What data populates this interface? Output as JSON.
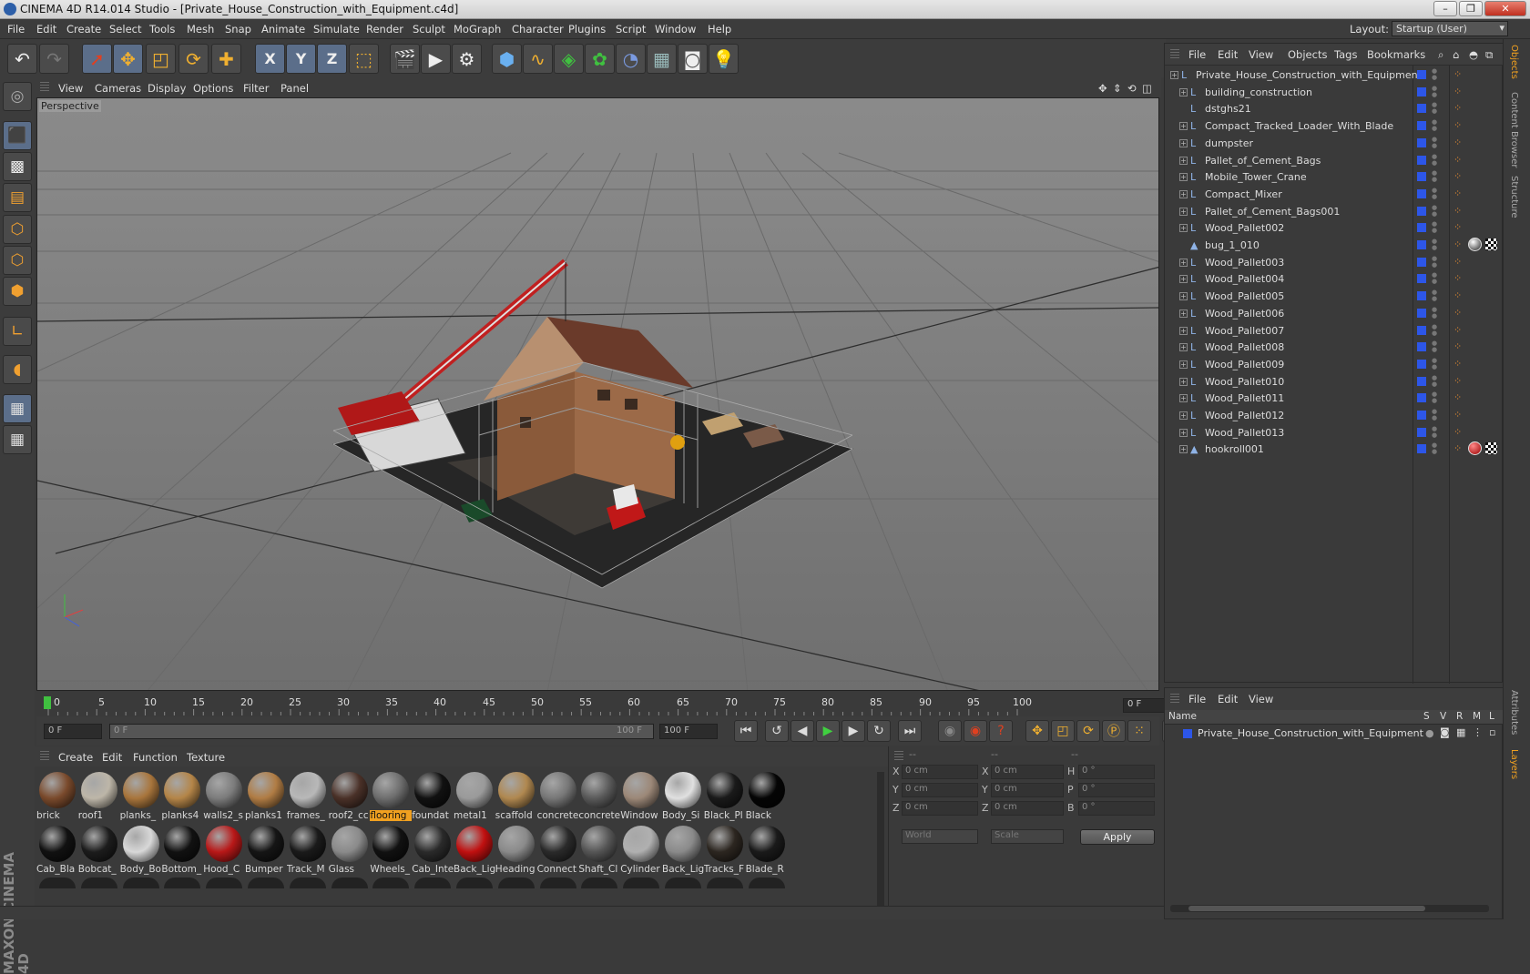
{
  "window": {
    "title": "CINEMA 4D R14.014 Studio - [Private_House_Construction_with_Equipment.c4d]"
  },
  "menubar": {
    "items": [
      "File",
      "Edit",
      "Create",
      "Select",
      "Tools",
      "Mesh",
      "Snap",
      "Animate",
      "Simulate",
      "Render",
      "Sculpt",
      "MoGraph",
      "Character",
      "Plugins",
      "Script",
      "Window",
      "Help"
    ],
    "layout_label": "Layout:",
    "layout_value": "Startup (User)"
  },
  "toolbar": {
    "icons": [
      "undo-icon",
      "redo-icon",
      "live-selection-icon",
      "move-icon",
      "scale-icon",
      "rotate-icon",
      "add-icon",
      "x-axis-icon",
      "y-axis-icon",
      "z-axis-icon",
      "coordinate-system-icon",
      "render-view-icon",
      "render-picture-viewer-icon",
      "render-settings-icon",
      "cube-icon",
      "spline-pen-icon",
      "subdivision-icon",
      "array-icon",
      "deformer-icon",
      "floor-icon",
      "camera-icon",
      "light-icon"
    ],
    "axis_labels": [
      "X",
      "Y",
      "Z"
    ]
  },
  "left_tools": [
    "make-editable-icon",
    "model-mode-icon",
    "texture-mode-icon",
    "workplane-mode-icon",
    "points-mode-icon",
    "edges-mode-icon",
    "polygons-mode-icon",
    "axis-mode-icon",
    "tweak-mode-icon",
    "snap-grid-icon",
    "lock-workplane-icon"
  ],
  "brand": "MAXON CINEMA 4D",
  "viewport": {
    "menu": [
      "View",
      "Cameras",
      "Display",
      "Options",
      "Filter",
      "Panel"
    ],
    "label": "Perspective"
  },
  "timeline": {
    "ticks": [
      "0",
      "5",
      "10",
      "15",
      "20",
      "25",
      "30",
      "35",
      "40",
      "45",
      "50",
      "55",
      "60",
      "65",
      "70",
      "75",
      "80",
      "85",
      "90",
      "95",
      "100"
    ],
    "current_frame": "0 F"
  },
  "transport": {
    "start_field": "0 F",
    "range_start": "0 F",
    "range_end": "100 F",
    "end_field": "100 F"
  },
  "material_manager": {
    "menu": [
      "Create",
      "Edit",
      "Function",
      "Texture"
    ],
    "materials": [
      {
        "name": "brick",
        "color": "#7a4a2c"
      },
      {
        "name": "roof1",
        "color": "#bdb6a8"
      },
      {
        "name": "planks_",
        "color": "#a8753c"
      },
      {
        "name": "planks4",
        "color": "#b48548"
      },
      {
        "name": "walls2_s",
        "color": "#7c7c7c"
      },
      {
        "name": "planks1",
        "color": "#b07c44"
      },
      {
        "name": "frames_",
        "color": "#b8b8b8"
      },
      {
        "name": "roof2_cc",
        "color": "#4a3128"
      },
      {
        "name": "flooring",
        "color": "#6e6e6e",
        "selected": true
      },
      {
        "name": "foundat",
        "color": "#111111"
      },
      {
        "name": "metal1",
        "color": "#9a9a9a"
      },
      {
        "name": "scaffold",
        "color": "#b08850"
      },
      {
        "name": "concrete",
        "color": "#777777"
      },
      {
        "name": "concrete",
        "color": "#5a5a5a"
      },
      {
        "name": "Window",
        "color": "#9c8878"
      },
      {
        "name": "Body_Si",
        "color": "#e0e0e0"
      },
      {
        "name": "Black_Pl",
        "color": "#1a1a1a"
      },
      {
        "name": "Black",
        "color": "#050505"
      },
      {
        "name": "Cab_Bla",
        "color": "#111111"
      },
      {
        "name": "Bobcat_",
        "color": "#1c1c1c"
      },
      {
        "name": "Body_Bo",
        "color": "#d8d8d8"
      },
      {
        "name": "Bottom_",
        "color": "#111111"
      },
      {
        "name": "Hood_C",
        "color": "#b81818"
      },
      {
        "name": "Bumper",
        "color": "#151515"
      },
      {
        "name": "Track_M",
        "color": "#1a1a1a"
      },
      {
        "name": "Glass",
        "color": "#8a8a8a"
      },
      {
        "name": "Wheels_",
        "color": "#111111"
      },
      {
        "name": "Cab_Inte",
        "color": "#2a2a2a"
      },
      {
        "name": "Back_Lig",
        "color": "#c01010"
      },
      {
        "name": "Heading",
        "color": "#8a8a8a"
      },
      {
        "name": "Connect",
        "color": "#2a2a2a"
      },
      {
        "name": "Shaft_Cl",
        "color": "#555555"
      },
      {
        "name": "Cylinder",
        "color": "#b0b0b0"
      },
      {
        "name": "Back_Lig",
        "color": "#8a8a8a"
      },
      {
        "name": "Tracks_F",
        "color": "#2c2620"
      },
      {
        "name": "Blade_R",
        "color": "#1a1a1a"
      }
    ]
  },
  "coordinates": {
    "col_headers": [
      "--",
      "--",
      "--"
    ],
    "rows": [
      {
        "a": "X",
        "av": "0 cm",
        "b": "X",
        "bv": "0 cm",
        "c": "H",
        "cv": "0 °"
      },
      {
        "a": "Y",
        "av": "0 cm",
        "b": "Y",
        "bv": "0 cm",
        "c": "P",
        "cv": "0 °"
      },
      {
        "a": "Z",
        "av": "0 cm",
        "b": "Z",
        "bv": "0 cm",
        "c": "B",
        "cv": "0 °"
      }
    ],
    "space": "World",
    "mode": "Scale",
    "apply": "Apply"
  },
  "object_manager": {
    "menu": [
      "File",
      "Edit",
      "View",
      "Objects",
      "Tags",
      "Bookmarks"
    ],
    "objects": [
      {
        "name": "Private_House_Construction_with_Equipment",
        "level": 0,
        "type": "null",
        "tags": ""
      },
      {
        "name": "building_construction",
        "level": 1,
        "type": "null",
        "tags": ""
      },
      {
        "name": "dstghs21",
        "level": 1,
        "type": "null",
        "tags": "",
        "leaf": true
      },
      {
        "name": "Compact_Tracked_Loader_With_Blade",
        "level": 1,
        "type": "null",
        "tags": ""
      },
      {
        "name": "dumpster",
        "level": 1,
        "type": "null",
        "tags": ""
      },
      {
        "name": "Pallet_of_Cement_Bags",
        "level": 1,
        "type": "null",
        "tags": ""
      },
      {
        "name": "Mobile_Tower_Crane",
        "level": 1,
        "type": "null",
        "tags": ""
      },
      {
        "name": "Compact_Mixer",
        "level": 1,
        "type": "null",
        "tags": ""
      },
      {
        "name": "Pallet_of_Cement_Bags001",
        "level": 1,
        "type": "null",
        "tags": ""
      },
      {
        "name": "Wood_Pallet002",
        "level": 1,
        "type": "null",
        "tags": ""
      },
      {
        "name": "bug_1_010",
        "level": 1,
        "type": "poly",
        "tags": "mat",
        "leaf": true
      },
      {
        "name": "Wood_Pallet003",
        "level": 1,
        "type": "null",
        "tags": ""
      },
      {
        "name": "Wood_Pallet004",
        "level": 1,
        "type": "null",
        "tags": ""
      },
      {
        "name": "Wood_Pallet005",
        "level": 1,
        "type": "null",
        "tags": ""
      },
      {
        "name": "Wood_Pallet006",
        "level": 1,
        "type": "null",
        "tags": ""
      },
      {
        "name": "Wood_Pallet007",
        "level": 1,
        "type": "null",
        "tags": ""
      },
      {
        "name": "Wood_Pallet008",
        "level": 1,
        "type": "null",
        "tags": ""
      },
      {
        "name": "Wood_Pallet009",
        "level": 1,
        "type": "null",
        "tags": ""
      },
      {
        "name": "Wood_Pallet010",
        "level": 1,
        "type": "null",
        "tags": ""
      },
      {
        "name": "Wood_Pallet011",
        "level": 1,
        "type": "null",
        "tags": ""
      },
      {
        "name": "Wood_Pallet012",
        "level": 1,
        "type": "null",
        "tags": ""
      },
      {
        "name": "Wood_Pallet013",
        "level": 1,
        "type": "null",
        "tags": ""
      },
      {
        "name": "hookroll001",
        "level": 1,
        "type": "poly",
        "tags": "mat-red"
      }
    ]
  },
  "layer_manager": {
    "menu": [
      "File",
      "Edit",
      "View"
    ],
    "headers": {
      "name": "Name",
      "flags": [
        "S",
        "V",
        "R",
        "M",
        "L"
      ]
    },
    "item": "Private_House_Construction_with_Equipment"
  },
  "right_tabs": [
    "Objects",
    "Content Browser",
    "Structure",
    "Attributes",
    "Layers"
  ],
  "colors": {
    "accent": "#f0a020",
    "layer_blue": "#2d56e8",
    "bg": "#3a3a3a"
  }
}
